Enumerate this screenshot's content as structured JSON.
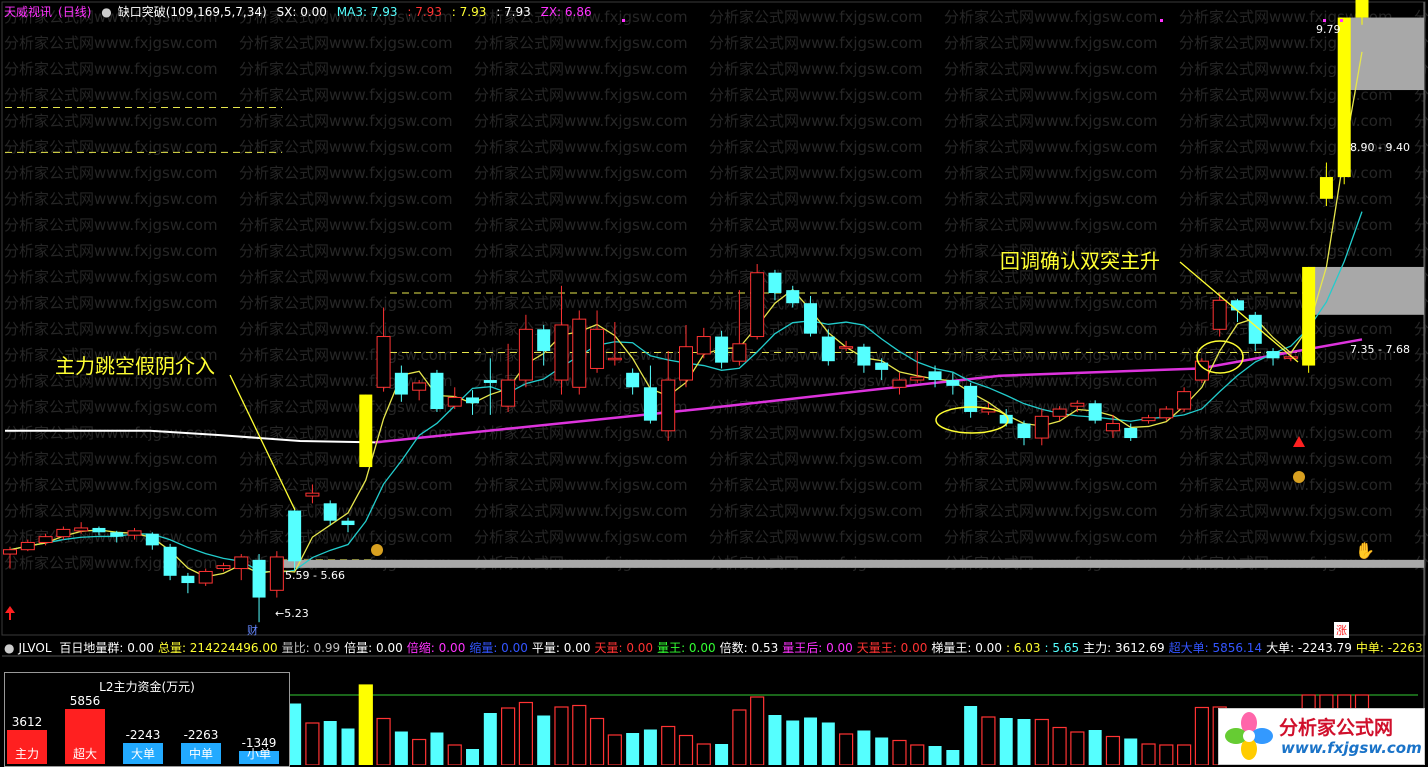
{
  "title_bar": {
    "app_name": "天威视讯",
    "period": "(日线)",
    "indicator": "缺口突破(109,169,5,7,34)",
    "sx": "SX: 0.00",
    "ma3": "MA3: 7.93",
    "v1": ": 7.93",
    "v2": ": 7.93",
    "v3": ": 7.93",
    "zx": "ZX: 6.86"
  },
  "annotations": {
    "left": "主力跳空假阴介入",
    "right": "回调确认双突主升"
  },
  "price_labels": {
    "top": "9.79",
    "zone_top": "8.90 - 9.40",
    "zone_mid": "7.35 - 7.68",
    "zone_low": "5.59 - 5.66",
    "low": "←5.23",
    "cai": "财",
    "zhang": "涨"
  },
  "indicator_bar": {
    "name": "JLVOL",
    "items": [
      {
        "label": "百日地量群: 0.00",
        "color": "#ffffff"
      },
      {
        "label": "总量: 214224496.00",
        "color": "#ffff33"
      },
      {
        "label": "量比: 0.99",
        "color": "#c0c0c0"
      },
      {
        "label": "倍量: 0.00",
        "color": "#ffffff"
      },
      {
        "label": "倍缩: 0.00",
        "color": "#ff33ff"
      },
      {
        "label": "缩量: 0.00",
        "color": "#3355ff"
      },
      {
        "label": "平量: 0.00",
        "color": "#ffffff"
      },
      {
        "label": "天量: 0.00",
        "color": "#ff3333"
      },
      {
        "label": "量王: 0.00",
        "color": "#33ff33"
      },
      {
        "label": "倍数: 0.53",
        "color": "#ffffff"
      },
      {
        "label": "量王后: 0.00",
        "color": "#ff33ff"
      },
      {
        "label": "天量王: 0.00",
        "color": "#ff3333"
      },
      {
        "label": "梯量王: 0.00",
        "color": "#ffffff"
      },
      {
        "label": ": 6.03",
        "color": "#ffff33"
      },
      {
        "label": ": 5.65",
        "color": "#55ffff"
      },
      {
        "label": "主力: 3612.69",
        "color": "#ffffff"
      },
      {
        "label": "超大单: 5856.14",
        "color": "#3355ff"
      },
      {
        "label": "大单: -2243.79",
        "color": "#ffffff"
      },
      {
        "label": "中单: -2263",
        "color": "#ffff33"
      }
    ]
  },
  "l2_box": {
    "title": "L2主力资金(万元)",
    "bars": [
      {
        "value": "3612",
        "label": "主力",
        "color": "#ff2020",
        "frac": 0.62
      },
      {
        "value": "5856",
        "label": "超大",
        "color": "#ff2020",
        "frac": 1.0
      },
      {
        "value": "-2243",
        "label": "大单",
        "color": "#22aaff",
        "frac": 0.38
      },
      {
        "value": "-2263",
        "label": "中单",
        "color": "#22aaff",
        "frac": 0.39
      },
      {
        "value": "-1349",
        "label": "小单",
        "color": "#22aaff",
        "frac": 0.23
      }
    ]
  },
  "logo": {
    "name": "分析家公式网",
    "url": "www.fxjgsw.com"
  },
  "watermark": "分析家公式网www.fxjgsw.com",
  "colors": {
    "up": "#ff3333",
    "down": "#55ffff",
    "gap": "#ffff00",
    "ma_yellow": "#e6e64c",
    "ma_cyan": "#22cccc",
    "ma_pink": "#dd33dd",
    "zone": "#a8a8a8"
  },
  "chart_data": {
    "type": "candlestick",
    "x": "daily bars",
    "candles": [
      [
        5.7,
        5.73,
        5.6,
        5.75
      ],
      [
        5.73,
        5.78,
        5.72,
        5.8
      ],
      [
        5.78,
        5.82,
        5.76,
        5.84
      ],
      [
        5.82,
        5.87,
        5.8,
        5.89
      ],
      [
        5.86,
        5.88,
        5.84,
        5.92
      ],
      [
        5.88,
        5.85,
        5.83,
        5.89
      ],
      [
        5.85,
        5.82,
        5.78,
        5.86
      ],
      [
        5.83,
        5.86,
        5.8,
        5.88
      ],
      [
        5.84,
        5.76,
        5.73,
        5.85
      ],
      [
        5.75,
        5.55,
        5.52,
        5.77
      ],
      [
        5.55,
        5.5,
        5.43,
        5.57
      ],
      [
        5.5,
        5.58,
        5.48,
        5.6
      ],
      [
        5.6,
        5.62,
        5.58,
        5.64
      ],
      [
        5.6,
        5.68,
        5.52,
        5.7
      ],
      [
        5.66,
        5.4,
        5.23,
        5.7
      ],
      [
        5.45,
        5.68,
        5.4,
        5.72
      ],
      [
        6.0,
        5.65,
        5.59,
        6.02
      ],
      [
        6.1,
        6.12,
        6.05,
        6.18
      ],
      [
        6.05,
        5.93,
        5.9,
        6.07
      ],
      [
        5.93,
        5.9,
        5.85,
        5.95
      ],
      [
        6.3,
        6.8,
        6.3,
        6.8
      ],
      [
        6.85,
        7.2,
        6.82,
        7.4
      ],
      [
        6.95,
        6.8,
        6.75,
        7.0
      ],
      [
        6.83,
        6.88,
        6.76,
        6.9
      ],
      [
        6.95,
        6.7,
        6.68,
        6.97
      ],
      [
        6.72,
        6.78,
        6.7,
        6.85
      ],
      [
        6.78,
        6.74,
        6.66,
        6.83
      ],
      [
        6.9,
        6.88,
        6.66,
        7.05
      ],
      [
        6.72,
        6.9,
        6.68,
        7.15
      ],
      [
        6.9,
        7.25,
        6.85,
        7.35
      ],
      [
        7.25,
        7.1,
        7.0,
        7.28
      ],
      [
        6.9,
        7.28,
        6.8,
        7.55
      ],
      [
        6.85,
        7.32,
        6.8,
        7.38
      ],
      [
        6.98,
        7.25,
        6.95,
        7.38
      ],
      [
        7.05,
        7.05,
        7.0,
        7.3
      ],
      [
        6.95,
        6.85,
        6.8,
        6.98
      ],
      [
        6.85,
        6.62,
        6.6,
        7.0
      ],
      [
        6.55,
        6.9,
        6.48,
        7.1
      ],
      [
        6.9,
        7.13,
        6.85,
        7.28
      ],
      [
        7.08,
        7.2,
        7.05,
        7.26
      ],
      [
        7.2,
        7.02,
        6.98,
        7.24
      ],
      [
        7.03,
        7.15,
        7.0,
        7.52
      ],
      [
        7.2,
        7.64,
        7.18,
        7.7
      ],
      [
        7.64,
        7.5,
        7.45,
        7.66
      ],
      [
        7.52,
        7.43,
        7.4,
        7.55
      ],
      [
        7.43,
        7.22,
        7.2,
        7.48
      ],
      [
        7.2,
        7.03,
        7.0,
        7.25
      ],
      [
        7.13,
        7.13,
        7.1,
        7.17
      ],
      [
        7.13,
        7.0,
        6.95,
        7.15
      ],
      [
        7.02,
        6.97,
        6.9,
        7.05
      ],
      [
        6.85,
        6.9,
        6.8,
        6.95
      ],
      [
        6.9,
        6.92,
        6.88,
        7.1
      ],
      [
        6.96,
        6.9,
        6.85,
        7.0
      ],
      [
        6.9,
        6.86,
        6.8,
        6.95
      ],
      [
        6.86,
        6.68,
        6.64,
        6.88
      ],
      [
        6.68,
        6.7,
        6.66,
        6.74
      ],
      [
        6.66,
        6.6,
        6.58,
        6.7
      ],
      [
        6.6,
        6.5,
        6.45,
        6.62
      ],
      [
        6.5,
        6.65,
        6.45,
        6.7
      ],
      [
        6.65,
        6.7,
        6.62,
        6.72
      ],
      [
        6.72,
        6.74,
        6.68,
        6.76
      ],
      [
        6.74,
        6.62,
        6.6,
        6.76
      ],
      [
        6.55,
        6.6,
        6.5,
        6.66
      ],
      [
        6.57,
        6.5,
        6.48,
        6.6
      ],
      [
        6.62,
        6.64,
        6.6,
        6.66
      ],
      [
        6.64,
        6.7,
        6.62,
        6.72
      ],
      [
        6.7,
        6.82,
        6.68,
        6.85
      ],
      [
        6.9,
        7.03,
        6.88,
        7.05
      ],
      [
        7.25,
        7.45,
        7.2,
        7.5
      ],
      [
        7.45,
        7.38,
        7.3,
        7.46
      ],
      [
        7.35,
        7.15,
        7.1,
        7.37
      ],
      [
        7.1,
        7.05,
        7.0,
        7.12
      ],
      [
        7.05,
        7.06,
        7.03,
        7.08
      ],
      [
        7.0,
        7.68,
        6.95,
        7.68
      ],
      [
        8.15,
        8.3,
        8.1,
        8.4
      ],
      [
        8.3,
        9.4,
        8.25,
        9.4
      ],
      [
        9.4,
        9.79,
        9.35,
        9.79
      ]
    ]
  }
}
